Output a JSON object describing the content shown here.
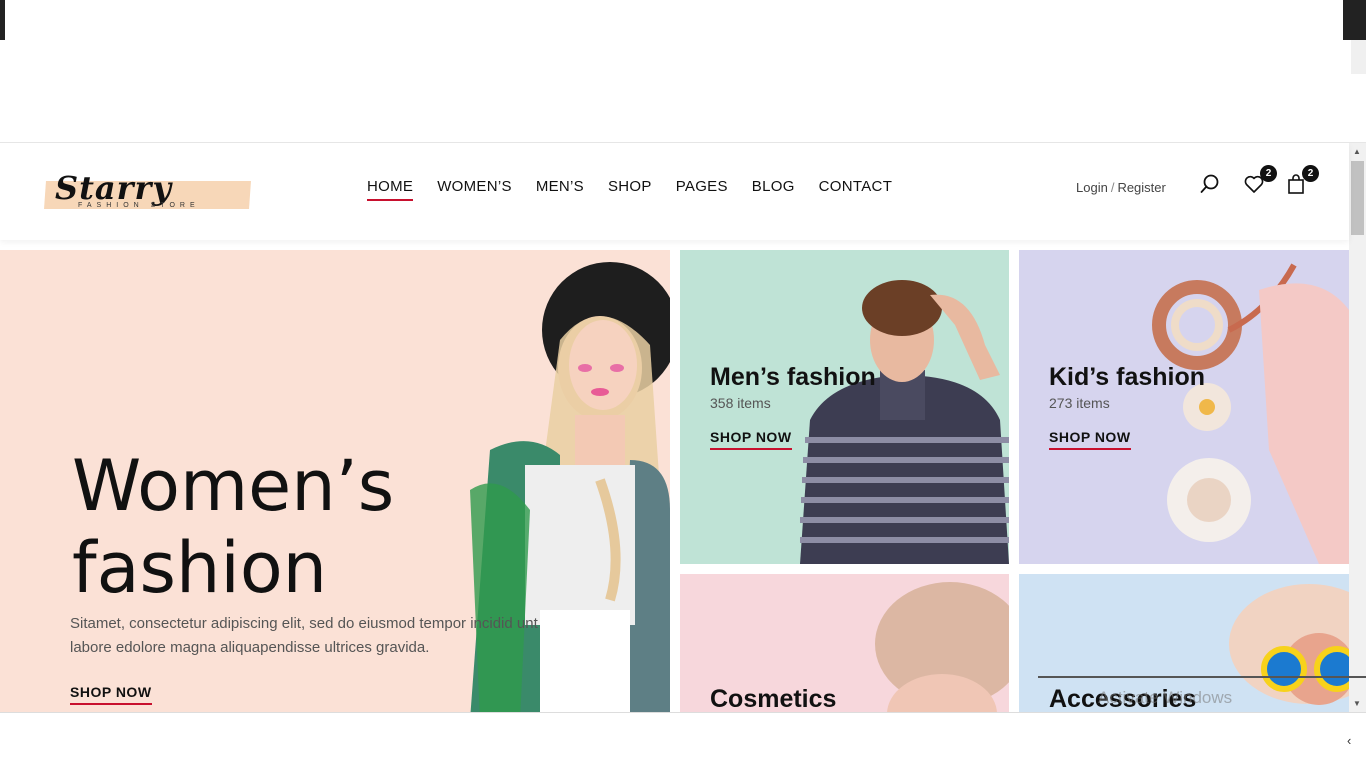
{
  "header": {
    "logo_text": "Starry",
    "logo_sub": "FASHION STORE",
    "nav": [
      "HOME",
      "WOMEN’S",
      "MEN’S",
      "SHOP",
      "PAGES",
      "BLOG",
      "CONTACT"
    ],
    "login": "Login",
    "register": "Register",
    "separator": "/",
    "wishlist_count": "2",
    "cart_count": "2",
    "icons": [
      "search-icon",
      "heart-icon",
      "shopping-bag-icon"
    ]
  },
  "hero": {
    "title_line1": "Women’s",
    "title_line2": "fashion",
    "description": "Sitamet, consectetur adipiscing elit, sed do eiusmod tempor incidid unt labore edolore magna aliquapendisse ultrices gravida.",
    "shop_label": "SHOP NOW"
  },
  "categories": [
    {
      "title": "Men’s fashion",
      "count": "358 items",
      "shop_label": "SHOP NOW"
    },
    {
      "title": "Kid’s fashion",
      "count": "273 items",
      "shop_label": "SHOP NOW"
    },
    {
      "title": "Cosmetics"
    },
    {
      "title": "Accessories"
    }
  ],
  "watermark": "Activate Windows",
  "colors": {
    "accent": "#c8102e",
    "hero_bg": "#fbe1d6",
    "men_bg": "#bfe3d6",
    "kid_bg": "#d6d4ee",
    "cosmetics_bg": "#f7d7dc",
    "accessories_bg": "#cfe2f3"
  }
}
